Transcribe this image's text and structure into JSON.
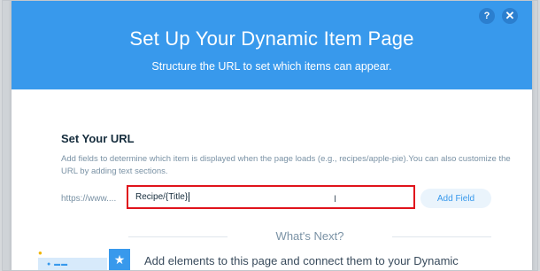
{
  "dialog": {
    "title": "Set Up Your Dynamic Item Page",
    "subtitle": "Structure the URL to set which items can appear.",
    "help_label": "?",
    "close_label": "✕"
  },
  "url_section": {
    "title": "Set Your URL",
    "description": "Add fields to determine which item is displayed when the page loads (e.g., recipes/apple-pie).You can also customize the URL by adding text sections.",
    "prefix": "https://www....",
    "input_value": "Recipe/{Title}",
    "add_field_label": "Add Field"
  },
  "whats_next": {
    "heading": "What's Next?",
    "text": "Add elements to this page and connect them to your Dynamic"
  },
  "colors": {
    "header": "#3899ec",
    "input_highlight": "#e0131c",
    "title_text": "#162d3d",
    "muted_text": "#7a92a5"
  }
}
